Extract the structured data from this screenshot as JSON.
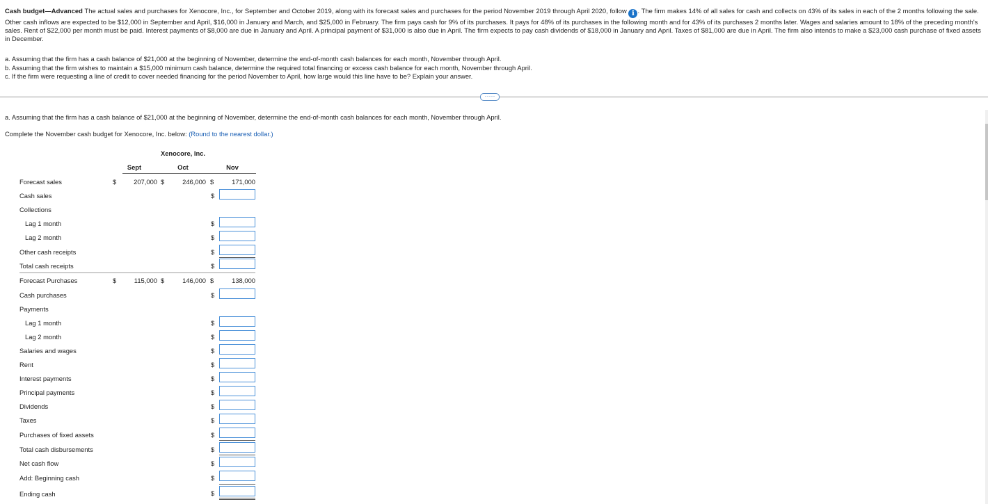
{
  "problem": {
    "title": "Cash budget—Advanced",
    "text_before_icon": " The actual sales and purchases for Xenocore, Inc., for September and October 2019, along with its forecast sales and purchases for the period November 2019 through April 2020, follow ",
    "info_icon": "i",
    "text_after_icon": ". The firm makes 14% of all sales for cash and collects on 43% of its sales in each of the 2 months following the sale. Other cash inflows are expected to be $12,000 in September and April, $16,000 in January and March, and $25,000 in February. The firm pays cash for 9% of its purchases. It pays for 48% of its purchases in the following month and for 43% of its purchases 2 months later. Wages and salaries amount to 18% of the preceding month's sales. Rent of $22,000 per month must be paid. Interest payments of $8,000 are due in January and April. A principal payment of $31,000 is also due in April. The firm expects to pay cash dividends of $18,000 in January and April. Taxes of $81,000 are due in April. The firm also intends to make a $23,000 cash purchase of fixed assets in December.",
    "parts": [
      "a. Assuming that the firm has a cash balance of $21,000 at the beginning of November, determine the end-of-month cash balances for each month, November through April.",
      "b. Assuming that the firm wishes to maintain a $15,000 minimum cash balance, determine the required total financing or excess cash balance for each month, November through April.",
      "c. If the firm were requesting a line of credit to cover needed financing for the period November to April, how large would this line have to be? Explain your answer."
    ]
  },
  "divider_handle": "·····",
  "question_a": "a. Assuming that the firm has a cash balance of $21,000 at the beginning of November, determine the end-of-month cash balances for each month, November through April.",
  "instruction": "Complete the November cash budget for Xenocore, Inc. below: ",
  "instruction_hint": "(Round to the nearest dollar.)",
  "table": {
    "company": "Xenocore, Inc.",
    "columns": [
      "Sept",
      "Oct",
      "Nov"
    ],
    "currency": "$",
    "forecast_sales": {
      "label": "Forecast sales",
      "sept": "207,000",
      "oct": "246,000",
      "nov": "171,000"
    },
    "forecast_purchases": {
      "label": "Forecast Purchases",
      "sept": "115,000",
      "oct": "146,000",
      "nov": "138,000"
    },
    "labels": {
      "cash_sales": "Cash sales",
      "collections": "Collections",
      "lag1_collections": "Lag 1 month",
      "lag2_collections": "Lag 2 month",
      "other_receipts": "Other cash receipts",
      "total_receipts": "Total cash receipts",
      "cash_purchases": "Cash purchases",
      "payments": "Payments",
      "lag1_payments": "Lag 1 month",
      "lag2_payments": "Lag 2 month",
      "salaries": "Salaries and wages",
      "rent": "Rent",
      "interest": "Interest payments",
      "principal": "Principal payments",
      "dividends": "Dividends",
      "taxes": "Taxes",
      "fixed_assets": "Purchases of fixed assets",
      "total_disbursements": "Total cash disbursements",
      "net_cash_flow": "Net cash flow",
      "beginning_cash": "Add: Beginning cash",
      "ending_cash": "Ending cash"
    }
  },
  "colors": {
    "input_border": "#4a90d9",
    "hint": "#1a5fb4",
    "info_icon": "#1a73c9"
  }
}
